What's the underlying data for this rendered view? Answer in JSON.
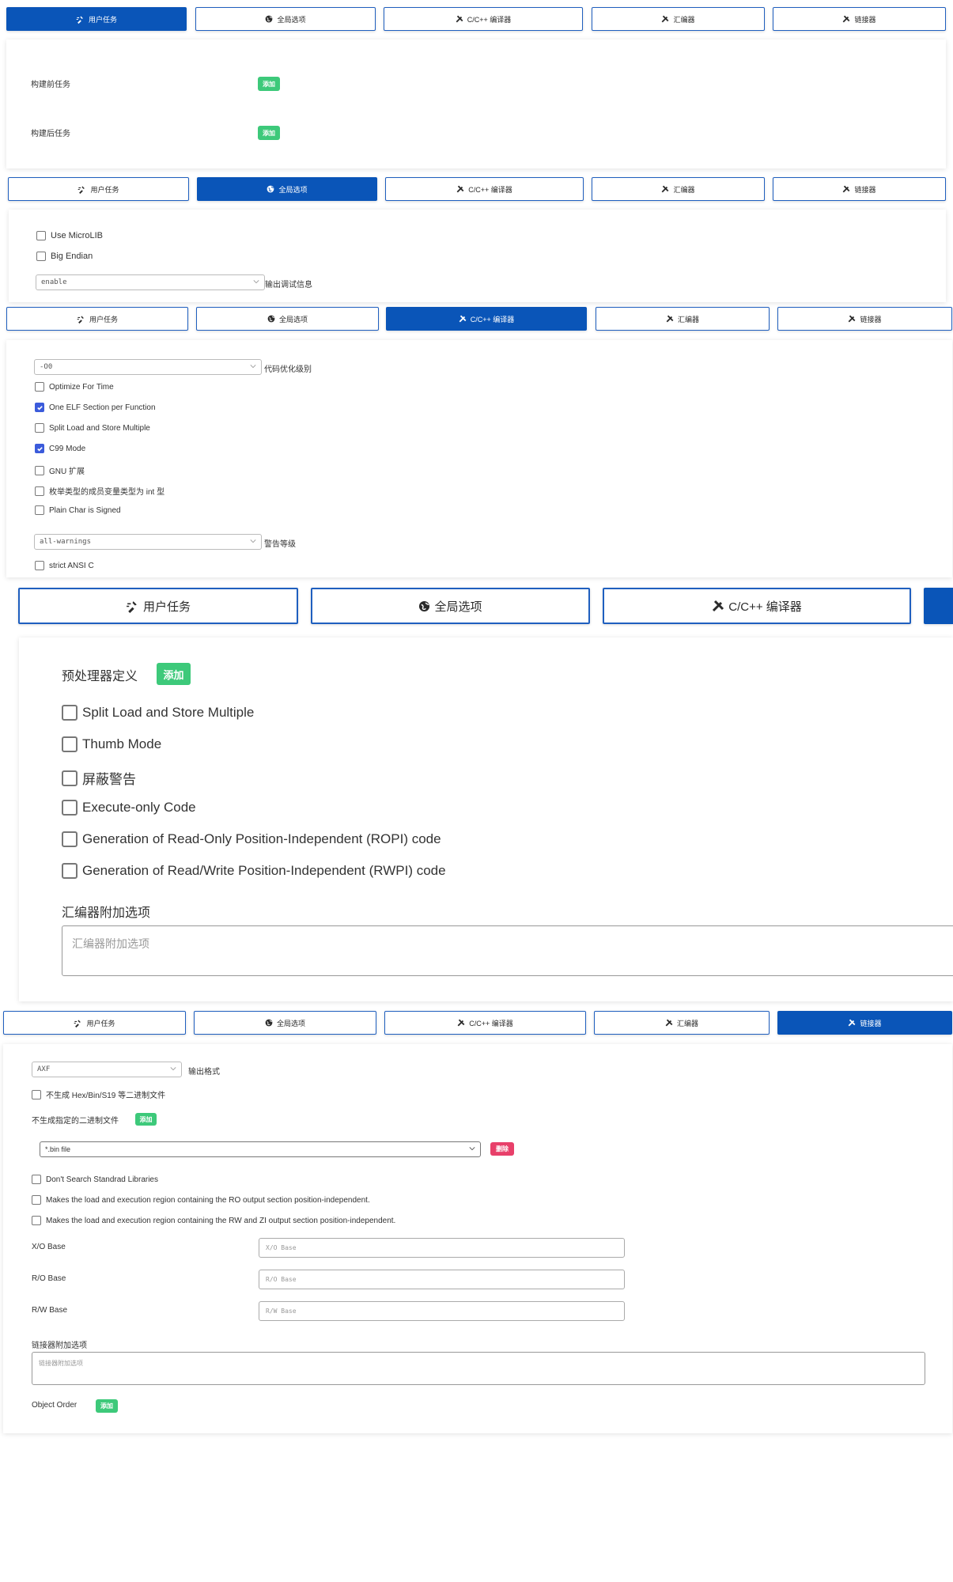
{
  "tabs": {
    "user_tasks": "用户任务",
    "global_options": "全局选项",
    "compiler": "C/C++ 编译器",
    "assembler": "汇编器",
    "linker": "链接器"
  },
  "common": {
    "add": "添加",
    "delete": "删除"
  },
  "user_tasks_panel": {
    "pre_build": "构建前任务",
    "post_build": "构建后任务"
  },
  "global_panel": {
    "use_microlib": "Use MicroLIB",
    "big_endian": "Big Endian",
    "debug_select_value": "enable",
    "debug_label": "输出调试信息"
  },
  "compiler_panel": {
    "opt_select_value": "-O0",
    "opt_label": "代码优化级别",
    "options": [
      {
        "label": "Optimize For Time",
        "checked": false
      },
      {
        "label": "One ELF Section per Function",
        "checked": true
      },
      {
        "label": "Split Load and Store Multiple",
        "checked": false
      },
      {
        "label": "C99 Mode",
        "checked": true
      },
      {
        "label": "GNU 扩展",
        "checked": false
      },
      {
        "label": "枚举类型的成员变量类型为 int 型",
        "checked": false
      },
      {
        "label": "Plain Char is Signed",
        "checked": false
      }
    ],
    "warn_select_value": "all-warnings",
    "warn_label": "警告等级",
    "strict_ansi": "strict ANSI C"
  },
  "assembler_panel": {
    "preprocessor_defs": "预处理器定义",
    "options": [
      "Split Load and Store Multiple",
      "Thumb Mode",
      "屏蔽警告",
      "Execute-only Code",
      "Generation of Read-Only Position-Independent (ROPI) code",
      "Generation of Read/Write Position-Independent (RWPI) code"
    ],
    "extra_label": "汇编器附加选项",
    "extra_placeholder": "汇编器附加选项"
  },
  "linker_panel": {
    "format_select_value": "AXF",
    "format_label": "输出格式",
    "no_hex_bin": "不生成 Hex/Bin/S19 等二进制文件",
    "no_specified_bin": "不生成指定的二进制文件",
    "bin_select_value": "*.bin file",
    "options": [
      "Don't Search Standrad Libraries",
      "Makes the load and execution region containing the RO output section position-independent.",
      "Makes the load and execution region containing the RW and ZI output section position-independent."
    ],
    "xo_base": "X/O Base",
    "ro_base": "R/O Base",
    "rw_base": "R/W Base",
    "xo_placeholder": "X/O Base",
    "ro_placeholder": "R/O Base",
    "rw_placeholder": "R/W Base",
    "extra_label": "链接器附加选项",
    "extra_placeholder": "链接器附加选项",
    "object_order": "Object Order"
  },
  "icons": {
    "user_tasks": "run-icon",
    "global_options": "globe-icon",
    "compiler": "tools-icon",
    "assembler": "tools-icon",
    "linker": "tools-icon",
    "select": "chevron-down-icon"
  },
  "colors": {
    "accent": "#0a55b8",
    "add": "#3dc97a",
    "delete": "#e8406a",
    "checkbox": "#3b5bdb"
  }
}
